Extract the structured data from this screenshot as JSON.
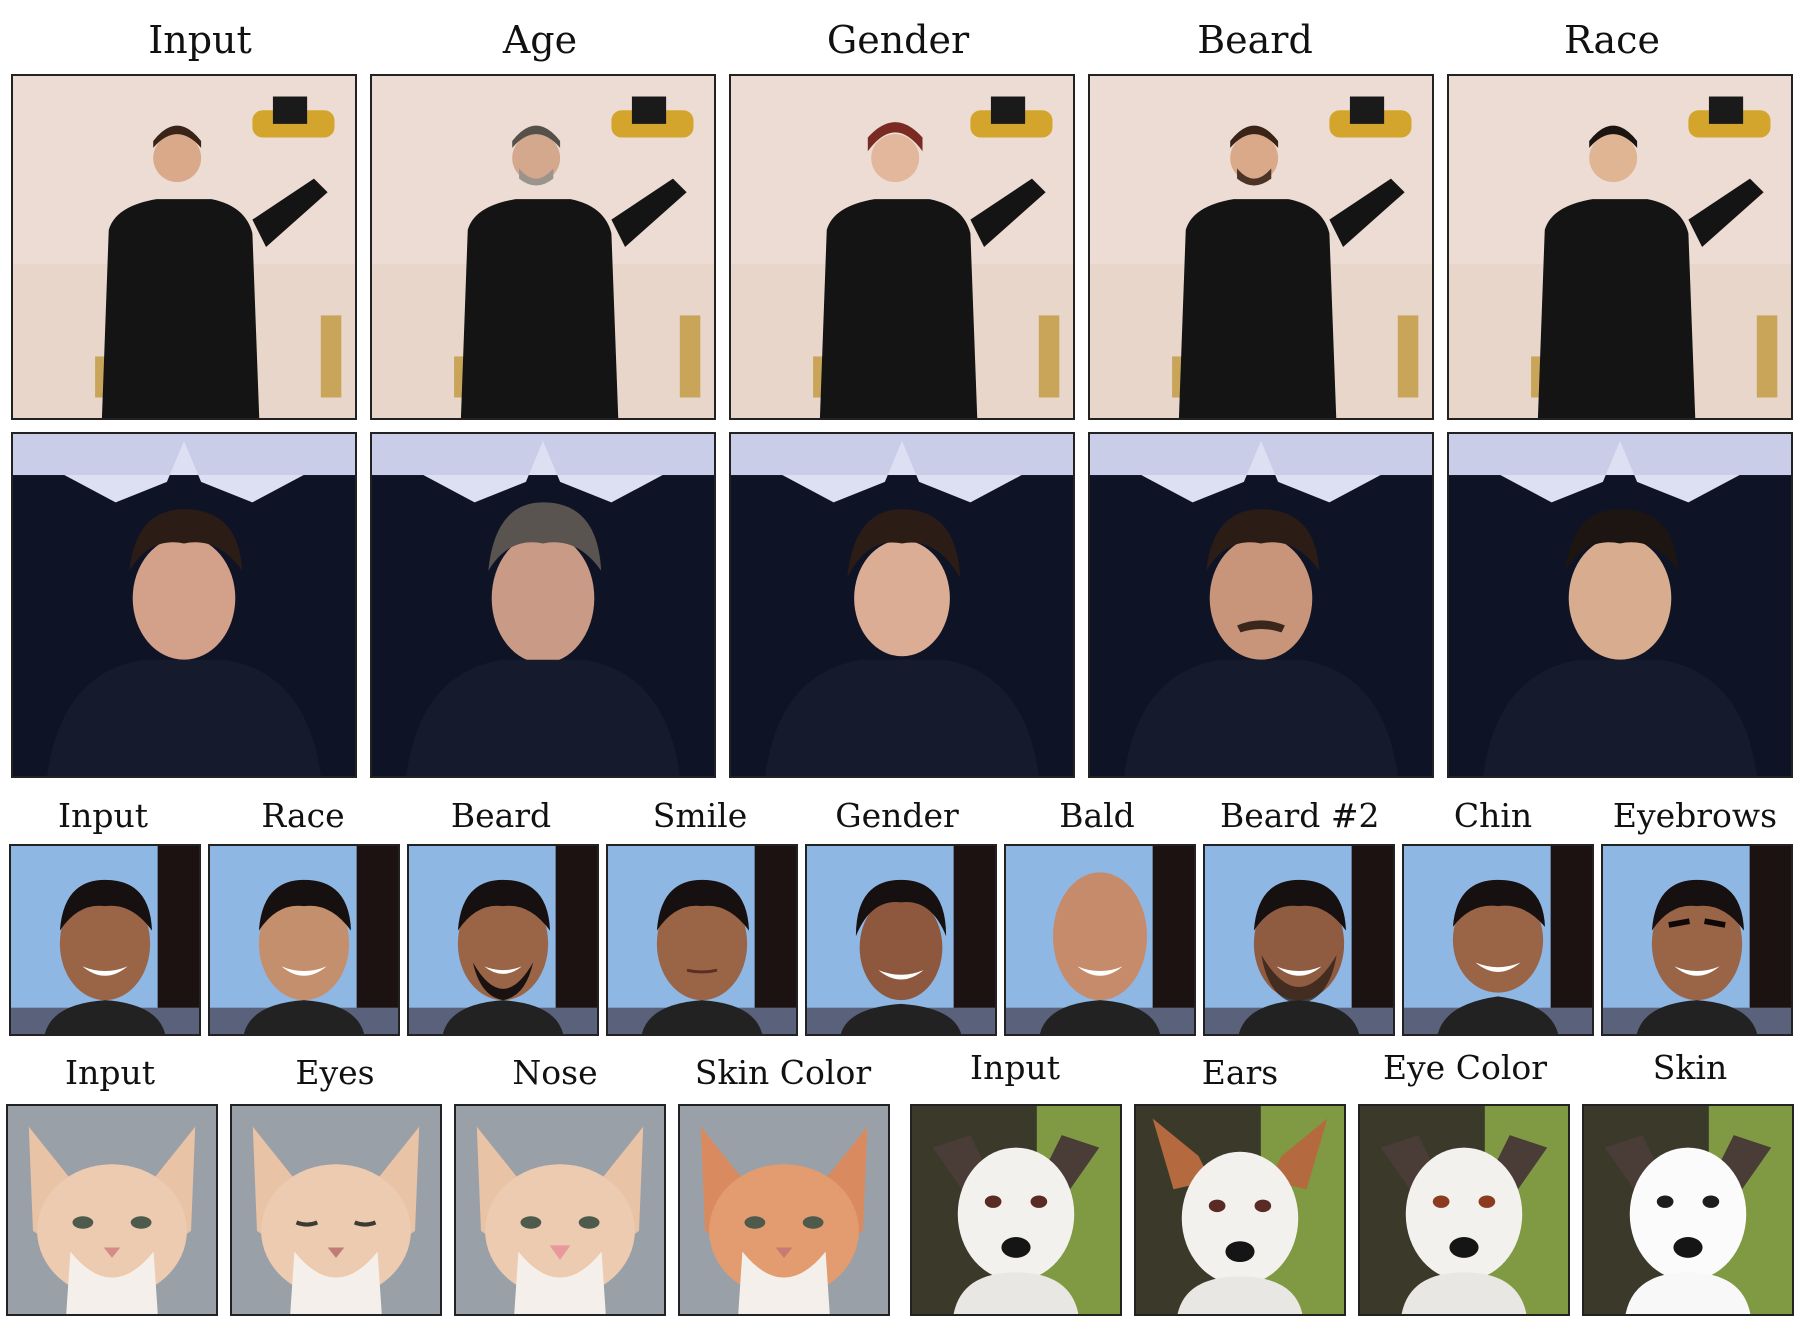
{
  "row1": {
    "labels": [
      "Input",
      "Age",
      "Gender",
      "Beard",
      "Race"
    ],
    "subject": "man in black suit holding golden statuette"
  },
  "row2": {
    "labels": [],
    "subject": "man in dark shirt in front of star logo"
  },
  "row3": {
    "labels": [
      "Input",
      "Race",
      "Beard",
      "Smile",
      "Gender",
      "Bald",
      "Beard #2",
      "Chin",
      "Eyebrows"
    ],
    "subject": "smiling man portrait"
  },
  "row4_cat": {
    "labels": [
      "Input",
      "Eyes",
      "Nose",
      "Skin Color"
    ],
    "subject": "orange and white cat"
  },
  "row4_dog": {
    "labels": [
      "Input",
      "Ears",
      "Eye Color",
      "Skin"
    ],
    "subject": "white dog with dark ears"
  }
}
